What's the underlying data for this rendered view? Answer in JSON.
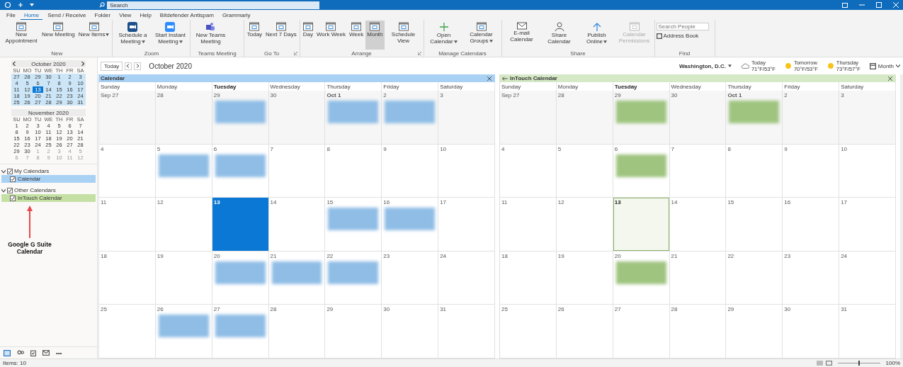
{
  "title_bar": {
    "search": {
      "placeholder": "Search"
    }
  },
  "menu_tabs": [
    {
      "label": "File",
      "selected": false
    },
    {
      "label": "Home",
      "selected": true
    },
    {
      "label": "Send / Receive",
      "selected": false
    },
    {
      "label": "Folder",
      "selected": false
    },
    {
      "label": "View",
      "selected": false
    },
    {
      "label": "Help",
      "selected": false
    },
    {
      "label": "Bitdefender Antispam",
      "selected": false
    },
    {
      "label": "Grammarly",
      "selected": false
    }
  ],
  "ribbon": [
    {
      "group": "New",
      "launcher": false,
      "buttons": [
        {
          "label": "New Appointment",
          "dropdown": false,
          "selected": false,
          "disabled": false
        },
        {
          "label": "New Meeting",
          "dropdown": false,
          "selected": false,
          "disabled": false
        },
        {
          "label": "New Items",
          "dropdown": true,
          "selected": false,
          "disabled": false
        }
      ]
    },
    {
      "group": "Zoom",
      "launcher": false,
      "buttons": [
        {
          "label": "Schedule a Meeting",
          "dropdown": true,
          "selected": false,
          "disabled": false
        },
        {
          "label": "Start Instant Meeting",
          "dropdown": true,
          "selected": false,
          "disabled": false
        }
      ]
    },
    {
      "group": "Teams Meeting",
      "launcher": false,
      "buttons": [
        {
          "label": "New Teams Meeting",
          "dropdown": false,
          "selected": false,
          "disabled": false
        }
      ]
    },
    {
      "group": "Go To",
      "launcher": true,
      "buttons": [
        {
          "label": "Today",
          "dropdown": false,
          "selected": false,
          "disabled": false
        },
        {
          "label": "Next 7 Days",
          "dropdown": false,
          "selected": false,
          "disabled": false
        }
      ]
    },
    {
      "group": "Arrange",
      "launcher": true,
      "buttons": [
        {
          "label": "Day",
          "dropdown": false,
          "selected": false,
          "disabled": false
        },
        {
          "label": "Work Week",
          "dropdown": false,
          "selected": false,
          "disabled": false
        },
        {
          "label": "Week",
          "dropdown": false,
          "selected": false,
          "disabled": false
        },
        {
          "label": "Month",
          "dropdown": false,
          "selected": true,
          "disabled": false
        },
        {
          "label": "Schedule View",
          "dropdown": false,
          "selected": false,
          "disabled": false
        }
      ]
    },
    {
      "group": "Manage Calendars",
      "launcher": false,
      "buttons": [
        {
          "label": "Open Calendar",
          "dropdown": true,
          "selected": false,
          "disabled": false
        },
        {
          "label": "Calendar Groups",
          "dropdown": true,
          "selected": false,
          "disabled": false
        }
      ]
    },
    {
      "group": "Share",
      "launcher": false,
      "buttons": [
        {
          "label": "E-mail Calendar",
          "dropdown": false,
          "selected": false,
          "disabled": false
        },
        {
          "label": "Share Calendar",
          "dropdown": false,
          "selected": false,
          "disabled": false
        },
        {
          "label": "Publish Online",
          "dropdown": true,
          "selected": false,
          "disabled": false
        },
        {
          "label": "Calendar Permissions",
          "dropdown": false,
          "selected": false,
          "disabled": true
        }
      ]
    }
  ],
  "find": {
    "group": "Find",
    "search_people": {
      "placeholder": "Search People"
    },
    "address_book": "Address Book"
  },
  "mini_calendars": [
    {
      "title": "October 2020",
      "nav": true,
      "highlighted": true,
      "weekdays": [
        "SU",
        "MO",
        "TU",
        "WE",
        "TH",
        "FR",
        "SA"
      ],
      "weeks": [
        [
          {
            "d": "27",
            "muted": false,
            "selected": false
          },
          {
            "d": "28",
            "muted": false,
            "selected": false
          },
          {
            "d": "29",
            "muted": false,
            "selected": false
          },
          {
            "d": "30",
            "muted": false,
            "selected": false
          },
          {
            "d": "1",
            "muted": false,
            "selected": false
          },
          {
            "d": "2",
            "muted": false,
            "selected": false
          },
          {
            "d": "3",
            "muted": false,
            "selected": false
          }
        ],
        [
          {
            "d": "4",
            "muted": false,
            "selected": false
          },
          {
            "d": "5",
            "muted": false,
            "selected": false
          },
          {
            "d": "6",
            "muted": false,
            "selected": false
          },
          {
            "d": "7",
            "muted": false,
            "selected": false
          },
          {
            "d": "8",
            "muted": false,
            "selected": false
          },
          {
            "d": "9",
            "muted": false,
            "selected": false
          },
          {
            "d": "10",
            "muted": false,
            "selected": false
          }
        ],
        [
          {
            "d": "11",
            "muted": false,
            "selected": false
          },
          {
            "d": "12",
            "muted": false,
            "selected": false
          },
          {
            "d": "13",
            "muted": false,
            "selected": true
          },
          {
            "d": "14",
            "muted": false,
            "selected": false
          },
          {
            "d": "15",
            "muted": false,
            "selected": false
          },
          {
            "d": "16",
            "muted": false,
            "selected": false
          },
          {
            "d": "17",
            "muted": false,
            "selected": false
          }
        ],
        [
          {
            "d": "18",
            "muted": false,
            "selected": false
          },
          {
            "d": "19",
            "muted": false,
            "selected": false
          },
          {
            "d": "20",
            "muted": false,
            "selected": false
          },
          {
            "d": "21",
            "muted": false,
            "selected": false
          },
          {
            "d": "22",
            "muted": false,
            "selected": false
          },
          {
            "d": "23",
            "muted": false,
            "selected": false
          },
          {
            "d": "24",
            "muted": false,
            "selected": false
          }
        ],
        [
          {
            "d": "25",
            "muted": false,
            "selected": false
          },
          {
            "d": "26",
            "muted": false,
            "selected": false
          },
          {
            "d": "27",
            "muted": false,
            "selected": false
          },
          {
            "d": "28",
            "muted": false,
            "selected": false
          },
          {
            "d": "29",
            "muted": false,
            "selected": false
          },
          {
            "d": "30",
            "muted": false,
            "selected": false
          },
          {
            "d": "31",
            "muted": false,
            "selected": false
          }
        ]
      ]
    },
    {
      "title": "November 2020",
      "nav": false,
      "highlighted": false,
      "weekdays": [
        "SU",
        "MO",
        "TU",
        "WE",
        "TH",
        "FR",
        "SA"
      ],
      "weeks": [
        [
          {
            "d": "1",
            "muted": false,
            "selected": false
          },
          {
            "d": "2",
            "muted": false,
            "selected": false
          },
          {
            "d": "3",
            "muted": false,
            "selected": false
          },
          {
            "d": "4",
            "muted": false,
            "selected": false
          },
          {
            "d": "5",
            "muted": false,
            "selected": false
          },
          {
            "d": "6",
            "muted": false,
            "selected": false
          },
          {
            "d": "7",
            "muted": false,
            "selected": false
          }
        ],
        [
          {
            "d": "8",
            "muted": false,
            "selected": false
          },
          {
            "d": "9",
            "muted": false,
            "selected": false
          },
          {
            "d": "10",
            "muted": false,
            "selected": false
          },
          {
            "d": "11",
            "muted": false,
            "selected": false
          },
          {
            "d": "12",
            "muted": false,
            "selected": false
          },
          {
            "d": "13",
            "muted": false,
            "selected": false
          },
          {
            "d": "14",
            "muted": false,
            "selected": false
          }
        ],
        [
          {
            "d": "15",
            "muted": false,
            "selected": false
          },
          {
            "d": "16",
            "muted": false,
            "selected": false
          },
          {
            "d": "17",
            "muted": false,
            "selected": false
          },
          {
            "d": "18",
            "muted": false,
            "selected": false
          },
          {
            "d": "19",
            "muted": false,
            "selected": false
          },
          {
            "d": "20",
            "muted": false,
            "selected": false
          },
          {
            "d": "21",
            "muted": false,
            "selected": false
          }
        ],
        [
          {
            "d": "22",
            "muted": false,
            "selected": false
          },
          {
            "d": "23",
            "muted": false,
            "selected": false
          },
          {
            "d": "24",
            "muted": false,
            "selected": false
          },
          {
            "d": "25",
            "muted": false,
            "selected": false
          },
          {
            "d": "26",
            "muted": false,
            "selected": false
          },
          {
            "d": "27",
            "muted": false,
            "selected": false
          },
          {
            "d": "28",
            "muted": false,
            "selected": false
          }
        ],
        [
          {
            "d": "29",
            "muted": false,
            "selected": false
          },
          {
            "d": "30",
            "muted": false,
            "selected": false
          },
          {
            "d": "1",
            "muted": true,
            "selected": false
          },
          {
            "d": "2",
            "muted": true,
            "selected": false
          },
          {
            "d": "3",
            "muted": true,
            "selected": false
          },
          {
            "d": "4",
            "muted": true,
            "selected": false
          },
          {
            "d": "5",
            "muted": true,
            "selected": false
          }
        ],
        [
          {
            "d": "6",
            "muted": true,
            "selected": false
          },
          {
            "d": "7",
            "muted": true,
            "selected": false
          },
          {
            "d": "8",
            "muted": true,
            "selected": false
          },
          {
            "d": "9",
            "muted": true,
            "selected": false
          },
          {
            "d": "10",
            "muted": true,
            "selected": false
          },
          {
            "d": "11",
            "muted": true,
            "selected": false
          },
          {
            "d": "12",
            "muted": true,
            "selected": false
          }
        ]
      ]
    }
  ],
  "calendar_groups": [
    {
      "label": "My Calendars",
      "checked": true,
      "expanded": true,
      "items": [
        {
          "label": "Calendar",
          "checked": true,
          "color": "#a9d1f4"
        }
      ]
    },
    {
      "label": "Other Calendars",
      "checked": true,
      "expanded": true,
      "items": [
        {
          "label": "InTouch Calendar",
          "checked": true,
          "color": "#c5e0a5"
        }
      ]
    }
  ],
  "annotation": "Google G Suite Calendar",
  "nav_more": "•••",
  "toolbar": {
    "today": "Today",
    "period": "October 2020",
    "location": "Washington, D.C.",
    "weather": [
      {
        "label": "Today",
        "temps": "71°F/53°F",
        "kind": "cloud"
      },
      {
        "label": "Tomorrow",
        "temps": "70°F/53°F",
        "kind": "sun"
      },
      {
        "label": "Thursday",
        "temps": "73°F/57°F",
        "kind": "sun"
      }
    ],
    "view": "Month"
  },
  "calendars": [
    {
      "title": "Calendar",
      "back_arrow": false,
      "color": "#a9d1f4",
      "weekdays": [
        {
          "label": "Sunday",
          "bold": false
        },
        {
          "label": "Monday",
          "bold": false
        },
        {
          "label": "Tuesday",
          "bold": true
        },
        {
          "label": "Wednesday",
          "bold": false
        },
        {
          "label": "Thursday",
          "bold": false
        },
        {
          "label": "Friday",
          "bold": false
        },
        {
          "label": "Saturday",
          "bold": false
        }
      ],
      "weeks": [
        [
          {
            "date": "Sep 27",
            "bold": false,
            "selected": false,
            "event": false
          },
          {
            "date": "28",
            "bold": false,
            "selected": false,
            "event": false
          },
          {
            "date": "29",
            "bold": false,
            "selected": false,
            "event": true
          },
          {
            "date": "30",
            "bold": false,
            "selected": false,
            "event": false
          },
          {
            "date": "Oct 1",
            "bold": true,
            "selected": false,
            "event": true
          },
          {
            "date": "2",
            "bold": false,
            "selected": false,
            "event": true
          },
          {
            "date": "3",
            "bold": false,
            "selected": false,
            "event": false
          }
        ],
        [
          {
            "date": "4",
            "bold": false,
            "selected": false,
            "event": false
          },
          {
            "date": "5",
            "bold": false,
            "selected": false,
            "event": true
          },
          {
            "date": "6",
            "bold": false,
            "selected": false,
            "event": true
          },
          {
            "date": "7",
            "bold": false,
            "selected": false,
            "event": false
          },
          {
            "date": "8",
            "bold": false,
            "selected": false,
            "event": false
          },
          {
            "date": "9",
            "bold": false,
            "selected": false,
            "event": false
          },
          {
            "date": "10",
            "bold": false,
            "selected": false,
            "event": false
          }
        ],
        [
          {
            "date": "11",
            "bold": false,
            "selected": false,
            "event": false
          },
          {
            "date": "12",
            "bold": false,
            "selected": false,
            "event": false
          },
          {
            "date": "13",
            "bold": true,
            "selected": true,
            "event": false
          },
          {
            "date": "14",
            "bold": false,
            "selected": false,
            "event": false
          },
          {
            "date": "15",
            "bold": false,
            "selected": false,
            "event": true
          },
          {
            "date": "16",
            "bold": false,
            "selected": false,
            "event": true
          },
          {
            "date": "17",
            "bold": false,
            "selected": false,
            "event": false
          }
        ],
        [
          {
            "date": "18",
            "bold": false,
            "selected": false,
            "event": false
          },
          {
            "date": "19",
            "bold": false,
            "selected": false,
            "event": false
          },
          {
            "date": "20",
            "bold": false,
            "selected": false,
            "event": true
          },
          {
            "date": "21",
            "bold": false,
            "selected": false,
            "event": true
          },
          {
            "date": "22",
            "bold": false,
            "selected": false,
            "event": true
          },
          {
            "date": "23",
            "bold": false,
            "selected": false,
            "event": false
          },
          {
            "date": "24",
            "bold": false,
            "selected": false,
            "event": false
          }
        ],
        [
          {
            "date": "25",
            "bold": false,
            "selected": false,
            "event": false
          },
          {
            "date": "26",
            "bold": false,
            "selected": false,
            "event": true
          },
          {
            "date": "27",
            "bold": false,
            "selected": false,
            "event": true
          },
          {
            "date": "28",
            "bold": false,
            "selected": false,
            "event": false
          },
          {
            "date": "29",
            "bold": false,
            "selected": false,
            "event": false
          },
          {
            "date": "30",
            "bold": false,
            "selected": false,
            "event": false
          },
          {
            "date": "31",
            "bold": false,
            "selected": false,
            "event": false
          }
        ]
      ]
    },
    {
      "title": "InTouch Calendar",
      "back_arrow": true,
      "color": "#d6e9c6",
      "weekdays": [
        {
          "label": "Sunday",
          "bold": false
        },
        {
          "label": "Monday",
          "bold": false
        },
        {
          "label": "Tuesday",
          "bold": true
        },
        {
          "label": "Wednesday",
          "bold": false
        },
        {
          "label": "Thursday",
          "bold": false
        },
        {
          "label": "Friday",
          "bold": false
        },
        {
          "label": "Saturday",
          "bold": false
        }
      ],
      "weeks": [
        [
          {
            "date": "Sep 27",
            "bold": false,
            "selected": false,
            "event": false
          },
          {
            "date": "28",
            "bold": false,
            "selected": false,
            "event": false
          },
          {
            "date": "29",
            "bold": false,
            "selected": false,
            "event": true
          },
          {
            "date": "30",
            "bold": false,
            "selected": false,
            "event": false
          },
          {
            "date": "Oct 1",
            "bold": true,
            "selected": false,
            "event": true
          },
          {
            "date": "2",
            "bold": false,
            "selected": false,
            "event": false
          },
          {
            "date": "3",
            "bold": false,
            "selected": false,
            "event": false
          }
        ],
        [
          {
            "date": "4",
            "bold": false,
            "selected": false,
            "event": false
          },
          {
            "date": "5",
            "bold": false,
            "selected": false,
            "event": false
          },
          {
            "date": "6",
            "bold": false,
            "selected": false,
            "event": true
          },
          {
            "date": "7",
            "bold": false,
            "selected": false,
            "event": false
          },
          {
            "date": "8",
            "bold": false,
            "selected": false,
            "event": false
          },
          {
            "date": "9",
            "bold": false,
            "selected": false,
            "event": false
          },
          {
            "date": "10",
            "bold": false,
            "selected": false,
            "event": false
          }
        ],
        [
          {
            "date": "11",
            "bold": false,
            "selected": false,
            "event": false
          },
          {
            "date": "12",
            "bold": false,
            "selected": false,
            "event": false
          },
          {
            "date": "13",
            "bold": true,
            "selected": true,
            "event": false
          },
          {
            "date": "14",
            "bold": false,
            "selected": false,
            "event": false
          },
          {
            "date": "15",
            "bold": false,
            "selected": false,
            "event": false
          },
          {
            "date": "16",
            "bold": false,
            "selected": false,
            "event": false
          },
          {
            "date": "17",
            "bold": false,
            "selected": false,
            "event": false
          }
        ],
        [
          {
            "date": "18",
            "bold": false,
            "selected": false,
            "event": false
          },
          {
            "date": "19",
            "bold": false,
            "selected": false,
            "event": false
          },
          {
            "date": "20",
            "bold": false,
            "selected": false,
            "event": true
          },
          {
            "date": "21",
            "bold": false,
            "selected": false,
            "event": false
          },
          {
            "date": "22",
            "bold": false,
            "selected": false,
            "event": false
          },
          {
            "date": "23",
            "bold": false,
            "selected": false,
            "event": false
          },
          {
            "date": "24",
            "bold": false,
            "selected": false,
            "event": false
          }
        ],
        [
          {
            "date": "25",
            "bold": false,
            "selected": false,
            "event": false
          },
          {
            "date": "26",
            "bold": false,
            "selected": false,
            "event": false
          },
          {
            "date": "27",
            "bold": false,
            "selected": false,
            "event": false
          },
          {
            "date": "28",
            "bold": false,
            "selected": false,
            "event": false
          },
          {
            "date": "29",
            "bold": false,
            "selected": false,
            "event": false
          },
          {
            "date": "30",
            "bold": false,
            "selected": false,
            "event": false
          },
          {
            "date": "31",
            "bold": false,
            "selected": false,
            "event": false
          }
        ]
      ]
    }
  ],
  "status_bar": {
    "items": "Items: 10",
    "zoom": "100%"
  }
}
